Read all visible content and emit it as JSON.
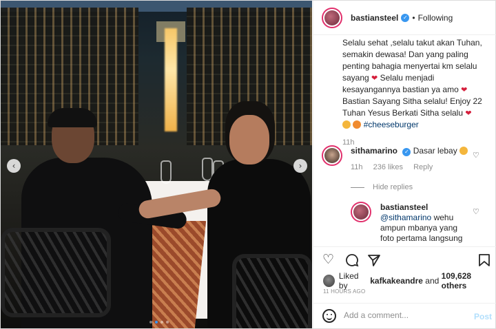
{
  "post": {
    "username": "bastiansteel",
    "follow_status": "Following",
    "separator": "•"
  },
  "caption": {
    "lines": [
      "Selalu sehat ,selalu takut akan Tuhan,",
      "semakin dewasa! Dan yang paling",
      "penting bahagia menyertai km selalu",
      "sayang",
      "Selalu menjadi",
      "kesayangannya bastian ya amo",
      "Bastian Sayang Sitha selalu! Enjoy 22",
      "Tuhan Yesus Berkati Sitha selalu",
      "#cheeseburger"
    ],
    "time": "11h"
  },
  "comments": [
    {
      "username": "sithamarino",
      "text": "Dasar lebay",
      "time": "11h",
      "likes": "236 likes",
      "reply": "Reply"
    }
  ],
  "hide_replies": "Hide replies",
  "reply": {
    "username": "bastiansteel",
    "mention": "@sithamarino",
    "text_line1": "wehu",
    "text_line2": "ampun mbanya yang",
    "text_line3": "foto pertama langsung"
  },
  "likes": {
    "prefix": "Liked by",
    "user": "kafkakeandre",
    "middle": "and",
    "count": "109,628 others"
  },
  "timestamp": "11 HOURS AGO",
  "comment_box": {
    "placeholder": "Add a comment...",
    "post_label": "Post"
  },
  "icons": {
    "heart": "heart-icon",
    "comment": "comment-icon",
    "share": "share-icon",
    "save": "bookmark-icon",
    "prev": "chevron-left-icon",
    "next": "chevron-right-icon"
  },
  "colors": {
    "verified": "#3897f0",
    "link": "#00376b",
    "muted": "#8e8e8e",
    "post_button": "#b2dffc",
    "story_ring": "#e1306c"
  },
  "carousel": {
    "current": 2,
    "total": 4
  }
}
